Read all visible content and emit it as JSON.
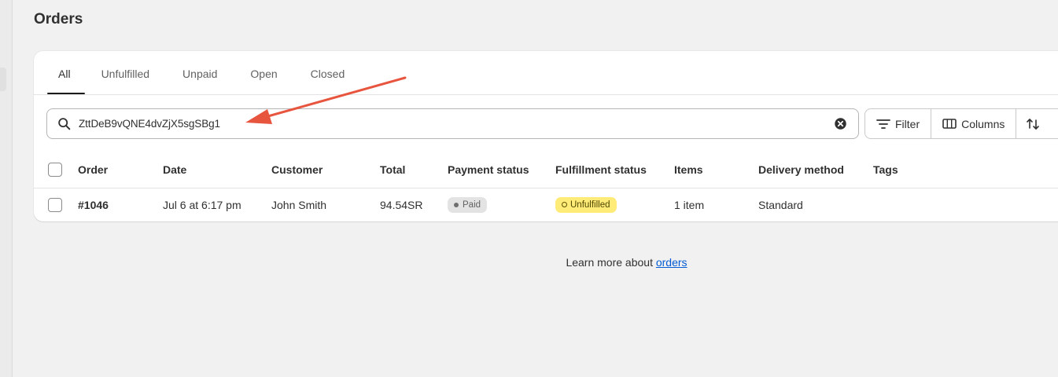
{
  "page": {
    "title": "Orders"
  },
  "tabs": [
    {
      "label": "All",
      "active": true
    },
    {
      "label": "Unfulfilled"
    },
    {
      "label": "Unpaid"
    },
    {
      "label": "Open"
    },
    {
      "label": "Closed"
    }
  ],
  "search": {
    "value": "ZttDeB9vQNE4dvZjX5sgSBg1",
    "icon": "search-icon",
    "clear_icon": "clear-circle-icon"
  },
  "toolbar": {
    "filter_label": "Filter",
    "columns_label": "Columns",
    "sort_icon": "sort-arrows-icon"
  },
  "table": {
    "headers": [
      "Order",
      "Date",
      "Customer",
      "Total",
      "Payment status",
      "Fulfillment status",
      "Items",
      "Delivery method",
      "Tags"
    ],
    "rows": [
      {
        "order": "#1046",
        "date": "Jul 6 at 6:17 pm",
        "customer": "John Smith",
        "total": "94.54SR",
        "payment_status": "Paid",
        "fulfillment_status": "Unfulfilled",
        "items": "1 item",
        "delivery_method": "Standard",
        "tags": ""
      }
    ]
  },
  "footer": {
    "prefix": "Learn more about ",
    "link": "orders"
  },
  "colors": {
    "accent": "#e8553f",
    "link": "#005bd3",
    "unfulfilled_badge": "#ffeb78",
    "paid_badge": "#e3e3e3"
  }
}
